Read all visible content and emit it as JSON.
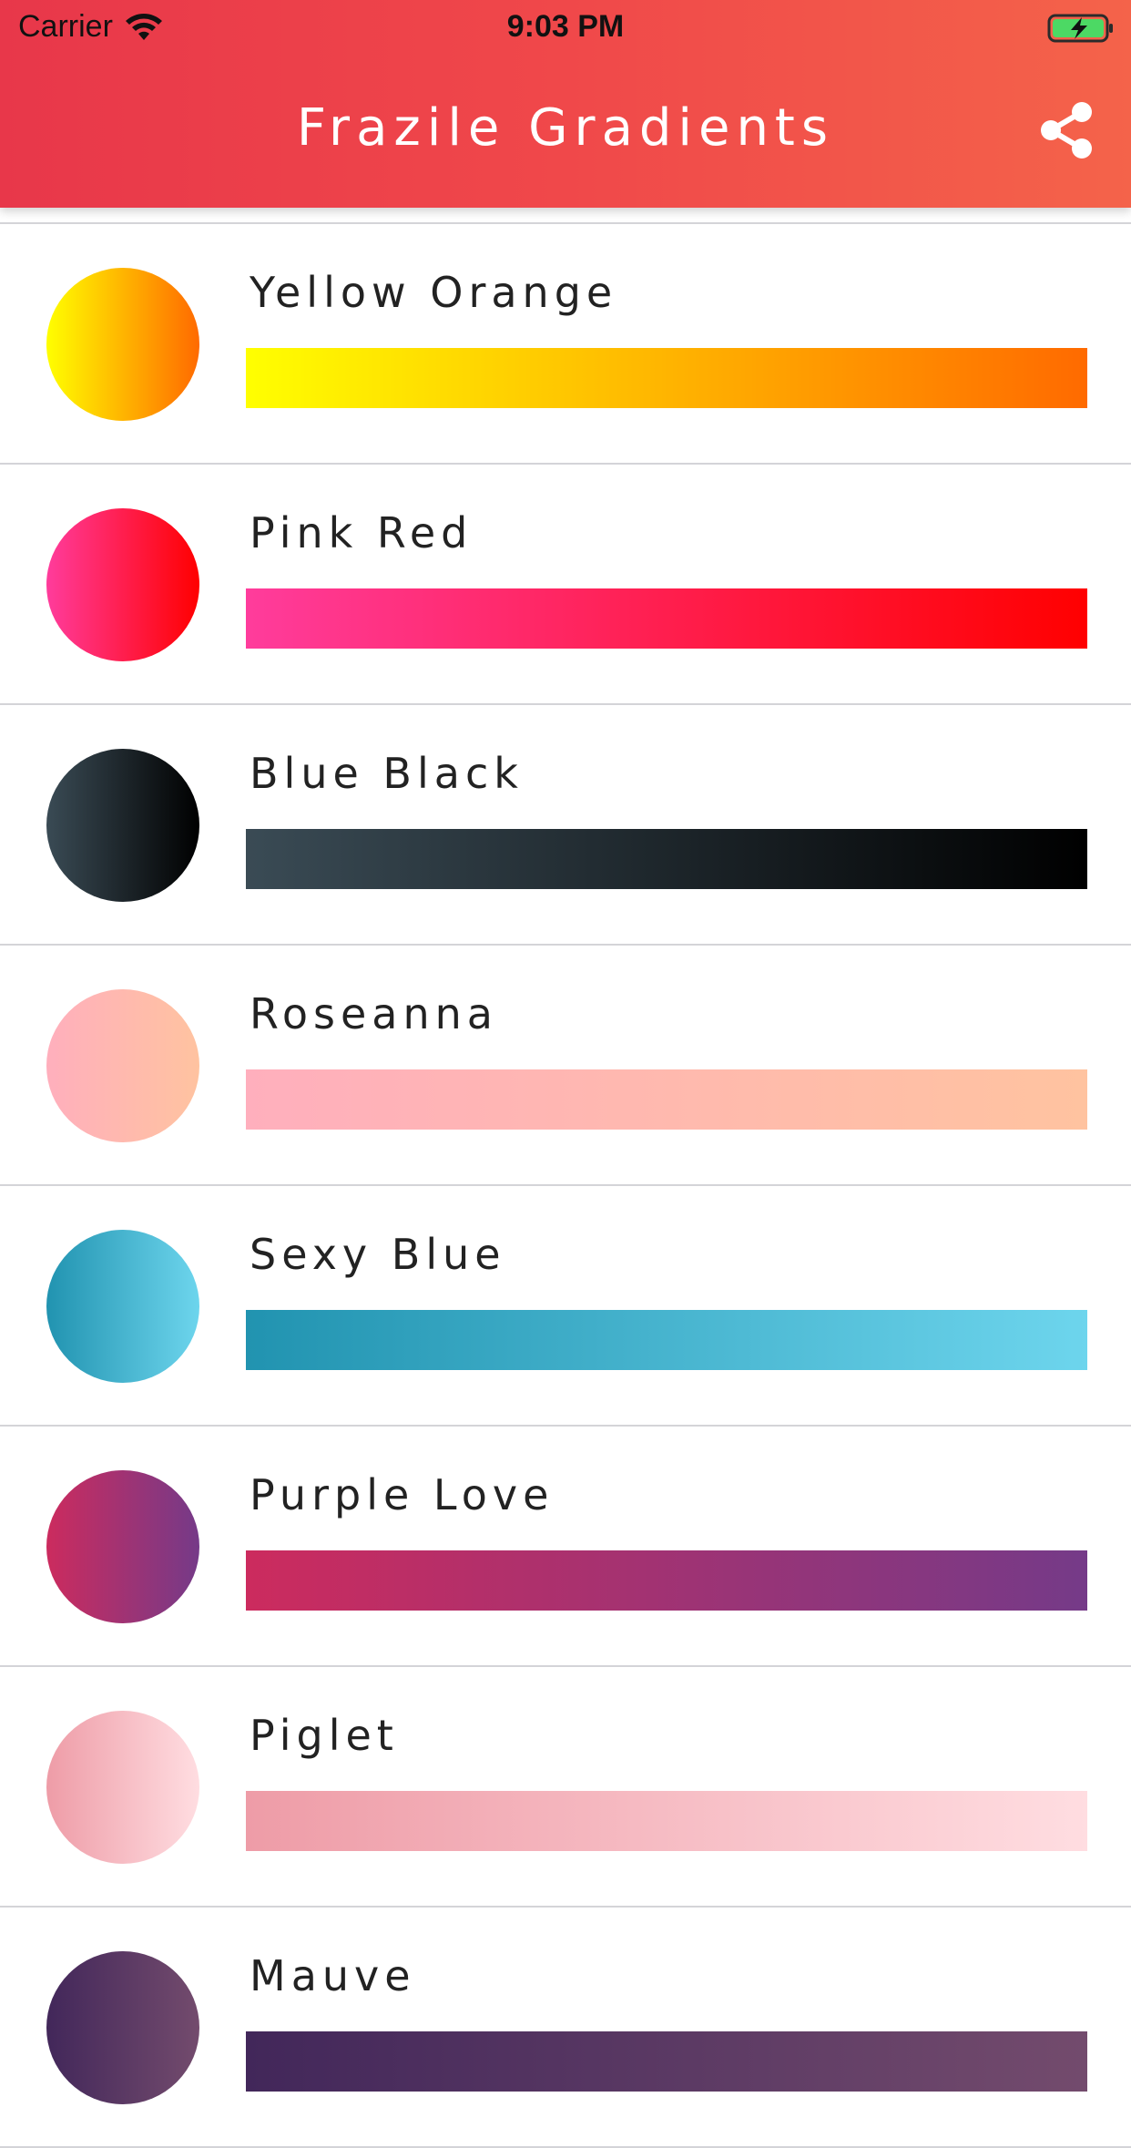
{
  "status_bar": {
    "carrier": "Carrier",
    "time": "9:03 PM"
  },
  "header": {
    "title": "Frazile Gradients",
    "share_icon": "share-icon"
  },
  "gradients": [
    {
      "name": "Yellow Orange",
      "from": "#FFFF00",
      "to": "#FF6A00"
    },
    {
      "name": "Pink Red",
      "from": "#FF3C9C",
      "to": "#FF0000"
    },
    {
      "name": "Blue Black",
      "from": "#3A4B55",
      "to": "#000000"
    },
    {
      "name": "Roseanna",
      "from": "#FFAFBD",
      "to": "#FFC3A0"
    },
    {
      "name": "Sexy Blue",
      "from": "#2193B0",
      "to": "#6DD5ED"
    },
    {
      "name": "Purple Love",
      "from": "#CC2B5E",
      "to": "#753A88"
    },
    {
      "name": "Piglet",
      "from": "#EE9CA7",
      "to": "#FFDDE1"
    },
    {
      "name": "Mauve",
      "from": "#42275A",
      "to": "#734B6D"
    }
  ]
}
